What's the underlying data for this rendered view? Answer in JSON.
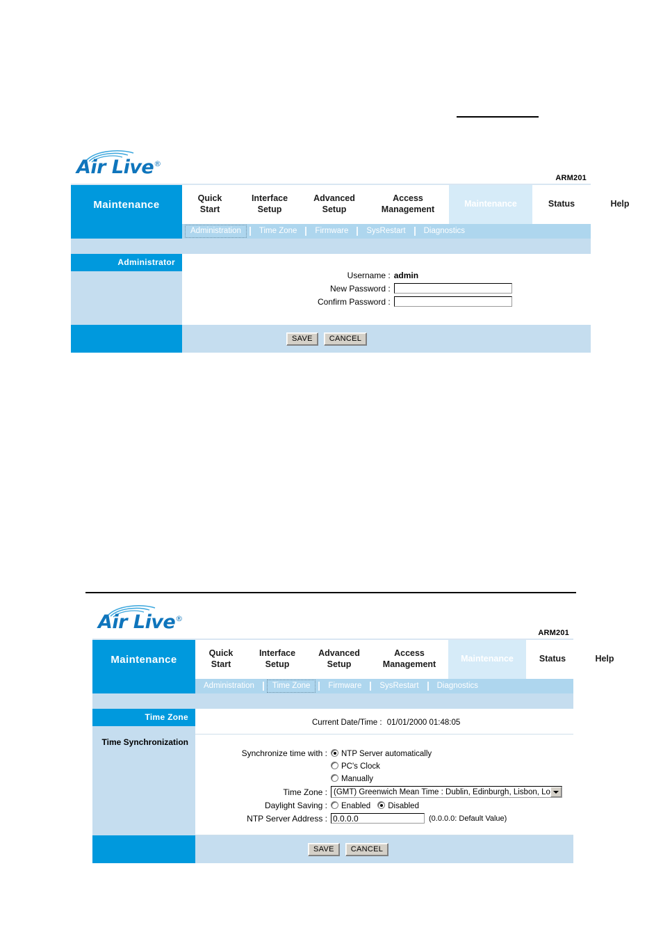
{
  "brand": {
    "logo_text": "Air Live",
    "logo_registered": "®",
    "model": "ARM201"
  },
  "nav": {
    "section_title": "Maintenance",
    "tabs": [
      {
        "label": "Quick\nStart",
        "active": false
      },
      {
        "label": "Interface\nSetup",
        "active": false
      },
      {
        "label": "Advanced\nSetup",
        "active": false
      },
      {
        "label": "Access\nManagement",
        "active": false
      },
      {
        "label": "Maintenance",
        "active": true
      },
      {
        "label": "Status",
        "active": false
      },
      {
        "label": "Help",
        "active": false
      }
    ],
    "subtabs": [
      "Administration",
      "Time Zone",
      "Firmware",
      "SysRestart",
      "Diagnostics"
    ]
  },
  "panel_admin": {
    "sidebar_heading": "Administrator",
    "focused_subtab": "Administration",
    "fields": {
      "username_label": "Username :",
      "username_value": "admin",
      "new_password_label": "New Password :",
      "new_password_value": "",
      "confirm_password_label": "Confirm Password :",
      "confirm_password_value": ""
    },
    "buttons": {
      "save": "SAVE",
      "cancel": "CANCEL"
    }
  },
  "panel_timezone": {
    "sidebar_heading": "Time Zone",
    "sidebar_subheading": "Time Synchronization",
    "focused_subtab": "Time Zone",
    "current_datetime_label": "Current Date/Time :",
    "current_datetime_value": "01/01/2000 01:48:05",
    "sync_label": "Synchronize time with :",
    "sync_options": [
      {
        "label": "NTP Server automatically",
        "checked": true
      },
      {
        "label": "PC's Clock",
        "checked": false
      },
      {
        "label": "Manually",
        "checked": false
      }
    ],
    "timezone_label": "Time Zone :",
    "timezone_value": "(GMT) Greenwich Mean Time : Dublin, Edinburgh, Lisbon, London",
    "daylight_label": "Daylight Saving :",
    "daylight_options": [
      {
        "label": "Enabled",
        "checked": false
      },
      {
        "label": "Disabled",
        "checked": true
      }
    ],
    "ntp_label": "NTP Server Address :",
    "ntp_value": "0.0.0.0",
    "ntp_hint": "(0.0.0.0: Default Value)",
    "buttons": {
      "save": "SAVE",
      "cancel": "CANCEL"
    }
  },
  "colors": {
    "brand_blue": "#0099dd",
    "light_blue": "#c5ddef",
    "subnav_blue": "#aed6ee",
    "active_tab": "#d6ebf8",
    "logo_blue": "#0f75bc"
  }
}
